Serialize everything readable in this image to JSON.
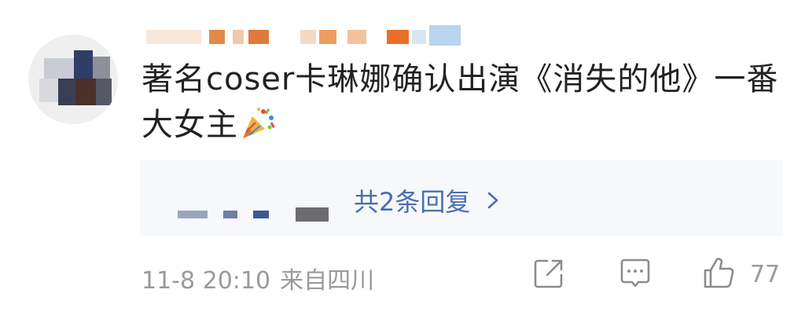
{
  "comment": {
    "text": "著名coser卡琳娜确认出演《消失的他》一番大女主"
  },
  "replies": {
    "label": "共2条回复"
  },
  "meta": {
    "date": "11-8 20:10",
    "location": "来自四川"
  },
  "actions": {
    "like_count": "77",
    "icons": [
      "share-icon",
      "comment-icon",
      "like-icon"
    ]
  },
  "colors": {
    "link": "#4a6fae",
    "meta_text": "#9a9a9a",
    "reply_box_bg": "#f7f8fa"
  }
}
